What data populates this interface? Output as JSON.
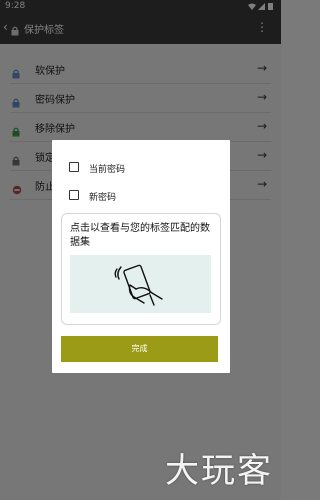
{
  "status_bar": {
    "time": "9:28"
  },
  "app_bar": {
    "back_icon": "chevron-left",
    "lock_icon": "lock",
    "title": "保护标签",
    "more_icon": "vertical-ellipsis"
  },
  "list": {
    "items": [
      {
        "label": "软保护",
        "icon": "lock-blue",
        "icon_color": "#5b8fc9"
      },
      {
        "label": "密码保护",
        "icon": "lock-blue",
        "icon_color": "#5b8fc9"
      },
      {
        "label": "移除保护",
        "icon": "lock-green",
        "icon_color": "#3e9a3e"
      },
      {
        "label": "锁定",
        "icon": "lock-grey",
        "icon_color": "#6e6e6e"
      },
      {
        "label": "防止",
        "icon": "no-entry",
        "icon_color": "#b04a4a"
      }
    ]
  },
  "dialog": {
    "current_password_label": "当前密码",
    "new_password_label": "新密码",
    "scan_prompt": "点击以查看与您的标签匹配的数据集",
    "done_label": "完成",
    "done_color": "#9b9b16"
  },
  "watermark": "大玩客"
}
